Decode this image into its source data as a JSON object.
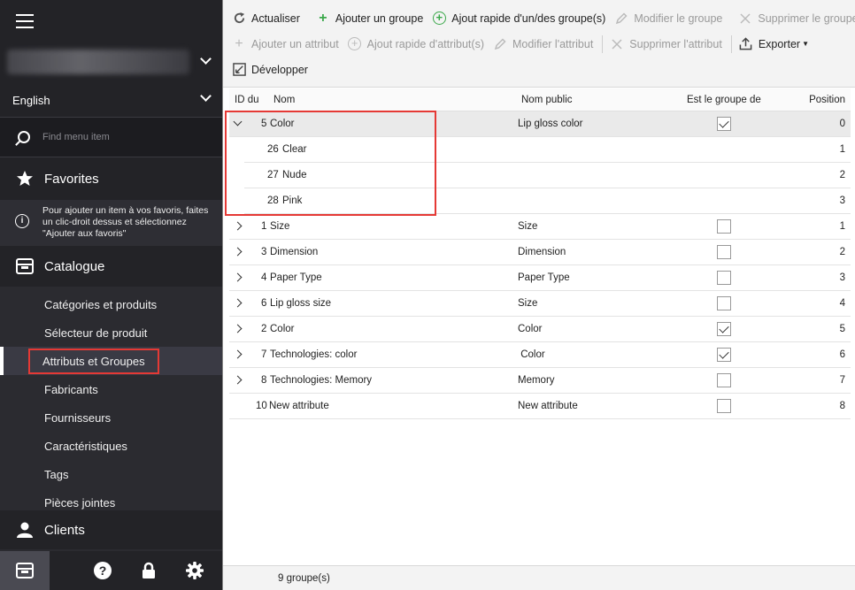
{
  "sidebar": {
    "language": "English",
    "search_placeholder": "Find menu item",
    "favorites_title": "Favorites",
    "favorites_hint": "Pour ajouter un item à vos favoris, faites un clic-droit dessus et sélectionnez \"Ajouter aux favoris\"",
    "catalogue_title": "Catalogue",
    "catalogue_items": [
      {
        "label": "Catégories et produits"
      },
      {
        "label": "Sélecteur de produit"
      },
      {
        "label": "Attributs et Groupes",
        "active": true
      },
      {
        "label": "Fabricants"
      },
      {
        "label": "Fournisseurs"
      },
      {
        "label": "Caractéristiques"
      },
      {
        "label": "Tags"
      },
      {
        "label": "Pièces jointes"
      }
    ],
    "clients_title": "Clients"
  },
  "toolbar": {
    "refresh": "Actualiser",
    "add_group": "Ajouter un groupe",
    "quick_add_group": "Ajout rapide d'un/des groupe(s)",
    "edit_group": "Modifier le groupe",
    "delete_group": "Supprimer le groupe",
    "add_attribute": "Ajouter un attribut",
    "quick_add_attribute": "Ajout rapide d'attribut(s)",
    "edit_attribute": "Modifier l'attribut",
    "delete_attribute": "Supprimer l'attribut",
    "export": "Exporter",
    "expand": "Développer"
  },
  "grid": {
    "columns": {
      "id": "ID du",
      "name": "Nom",
      "public_name": "Nom public",
      "is_color_group": "Est le groupe de",
      "position": "Position"
    },
    "footer": "9 groupe(s)",
    "rows": [
      {
        "id": "5",
        "name": "Color",
        "public": "Lip gloss color",
        "checked": true,
        "pos": "0",
        "expanded": true
      },
      {
        "id": "26",
        "name": "Clear",
        "pos": "1",
        "child": true
      },
      {
        "id": "27",
        "name": "Nude",
        "pos": "2",
        "child": true
      },
      {
        "id": "28",
        "name": "Pink",
        "pos": "3",
        "child": true
      },
      {
        "id": "1",
        "name": "Size",
        "public": "Size",
        "checked": false,
        "pos": "1"
      },
      {
        "id": "3",
        "name": "Dimension",
        "public": "Dimension",
        "checked": false,
        "pos": "2"
      },
      {
        "id": "4",
        "name": "Paper Type",
        "public": "Paper Type",
        "checked": false,
        "pos": "3"
      },
      {
        "id": "6",
        "name": "Lip gloss size",
        "public": "Size",
        "checked": false,
        "pos": "4"
      },
      {
        "id": "2",
        "name": "Color",
        "public": "Color",
        "checked": true,
        "pos": "5"
      },
      {
        "id": "7",
        "name": "Technologies:  color",
        "public": " Color",
        "checked": true,
        "pos": "6"
      },
      {
        "id": "8",
        "name": "Technologies: Memory",
        "public": "Memory",
        "checked": false,
        "pos": "7"
      },
      {
        "id": "10",
        "name": "New attribute",
        "public": "New attribute",
        "checked": false,
        "pos": "8",
        "noexp": true
      }
    ]
  }
}
